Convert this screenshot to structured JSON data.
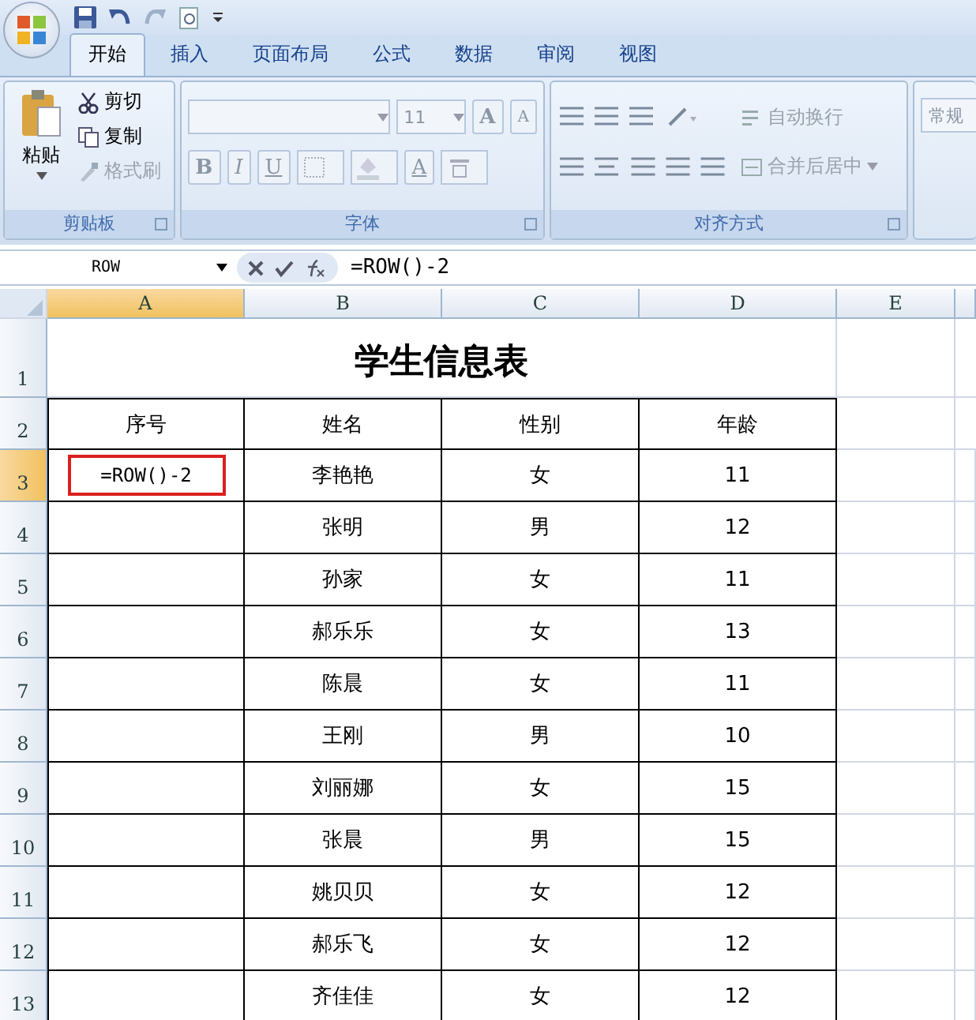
{
  "tabs": [
    {
      "label": "开始",
      "selected": true
    },
    {
      "label": "插入",
      "selected": false
    },
    {
      "label": "页面布局",
      "selected": false
    },
    {
      "label": "公式",
      "selected": false
    },
    {
      "label": "数据",
      "selected": false
    },
    {
      "label": "审阅",
      "selected": false
    },
    {
      "label": "视图",
      "selected": false
    }
  ],
  "ribbon": {
    "clipboard": {
      "paste": "粘贴",
      "cut": "剪切",
      "copy": "复制",
      "format_painter": "格式刷",
      "format_painter_disabled": true,
      "title": "剪贴板"
    },
    "font": {
      "size": "11",
      "grow": "A",
      "shrink": "A",
      "buttons": [
        {
          "kind": "bold",
          "label": "B"
        },
        {
          "kind": "italic",
          "label": "I"
        },
        {
          "kind": "underline",
          "label": "U"
        }
      ],
      "color_button": "A",
      "title": "字体"
    },
    "alignment": {
      "wrap": "自动换行",
      "merge": "合并后居中",
      "title": "对齐方式"
    },
    "number": {
      "format": "常规"
    }
  },
  "formula_bar": {
    "name_box": "ROW",
    "formula": "=ROW()-2"
  },
  "columns": [
    {
      "label": "A",
      "selected": true
    },
    {
      "label": "B",
      "selected": false
    },
    {
      "label": "C",
      "selected": false
    },
    {
      "label": "D",
      "selected": false
    },
    {
      "label": "E",
      "selected": false
    }
  ],
  "sheet": {
    "title_row": "1",
    "title": "学生信息表",
    "header_row": "2",
    "headers": [
      "序号",
      "姓名",
      "性别",
      "年龄"
    ],
    "rows": [
      {
        "number": "3",
        "selected": true,
        "index": "=ROW()-2",
        "name": "李艳艳",
        "gender": "女",
        "age": "11"
      },
      {
        "number": "4",
        "selected": false,
        "name": "张明",
        "gender": "男",
        "age": "12"
      },
      {
        "number": "5",
        "selected": false,
        "name": "孙家",
        "gender": "女",
        "age": "11"
      },
      {
        "number": "6",
        "selected": false,
        "name": "郝乐乐",
        "gender": "女",
        "age": "13"
      },
      {
        "number": "7",
        "selected": false,
        "name": "陈晨",
        "gender": "女",
        "age": "11"
      },
      {
        "number": "8",
        "selected": false,
        "name": "王刚",
        "gender": "男",
        "age": "10"
      },
      {
        "number": "9",
        "selected": false,
        "name": "刘丽娜",
        "gender": "女",
        "age": "15"
      },
      {
        "number": "10",
        "selected": false,
        "name": "张晨",
        "gender": "男",
        "age": "15"
      },
      {
        "number": "11",
        "selected": false,
        "name": "姚贝贝",
        "gender": "女",
        "age": "12"
      },
      {
        "number": "12",
        "selected": false,
        "name": "郝乐飞",
        "gender": "女",
        "age": "12"
      },
      {
        "number": "13",
        "selected": false,
        "name": "齐佳佳",
        "gender": "女",
        "age": "12"
      }
    ]
  }
}
